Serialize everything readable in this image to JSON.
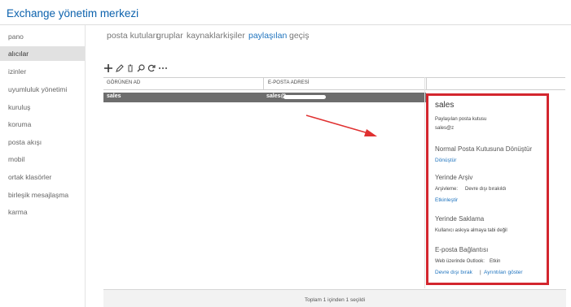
{
  "app": {
    "title": "Exchange yönetim merkezi"
  },
  "sidebar": {
    "items": [
      {
        "label": "pano"
      },
      {
        "label": "alıcılar"
      },
      {
        "label": "izinler"
      },
      {
        "label": "uyumluluk yönetimi"
      },
      {
        "label": "kuruluş"
      },
      {
        "label": "koruma"
      },
      {
        "label": "posta akışı"
      },
      {
        "label": "mobil"
      },
      {
        "label": "ortak klasörler"
      },
      {
        "label": "birleşik mesajlaşma"
      },
      {
        "label": "karma"
      }
    ]
  },
  "tabs": [
    {
      "label": "posta kutuları"
    },
    {
      "label": "gruplar"
    },
    {
      "label": "kaynaklar"
    },
    {
      "label": "kişiler"
    },
    {
      "label": "paylaşılan"
    },
    {
      "label": "geçiş"
    }
  ],
  "toolbar": {
    "icons": [
      "plus-icon",
      "edit-icon",
      "trash-icon",
      "search-icon",
      "refresh-icon",
      "more-icon"
    ]
  },
  "list": {
    "columns": [
      "GÖRÜNEN AD",
      "E-POSTA ADRESİ"
    ],
    "rows": [
      {
        "name": "sales",
        "email": "sales@"
      }
    ]
  },
  "footer": {
    "status": "Toplam 1 içinden 1 seçildi"
  },
  "detail": {
    "title": "sales",
    "type": "Paylaşılan posta kutusu",
    "email": "sales@z",
    "convert_head": "Normal Posta Kutusuna Dönüştür",
    "convert_link": "Dönüştür",
    "archive_head": "Yerinde Arşiv",
    "archive_label": "Arşivleme:",
    "archive_value": "Devre dışı bırakıldı",
    "archive_link": "Etkinleştir",
    "hold_head": "Yerinde Saklama",
    "hold_text": "Kullanıcı askıya almaya tabi değil",
    "email_conn_head": "E-posta Bağlantısı",
    "owa_label": "Web üzerinde Outlook:",
    "owa_value": "Etkin",
    "disable_link": "Devre dışı bırak",
    "link_sep": "|",
    "details_link": "Ayrıntıları göster"
  },
  "colors": {
    "accent": "#1e73be",
    "highlight_border": "#d3262e",
    "selected_row": "#6d6d6d"
  }
}
